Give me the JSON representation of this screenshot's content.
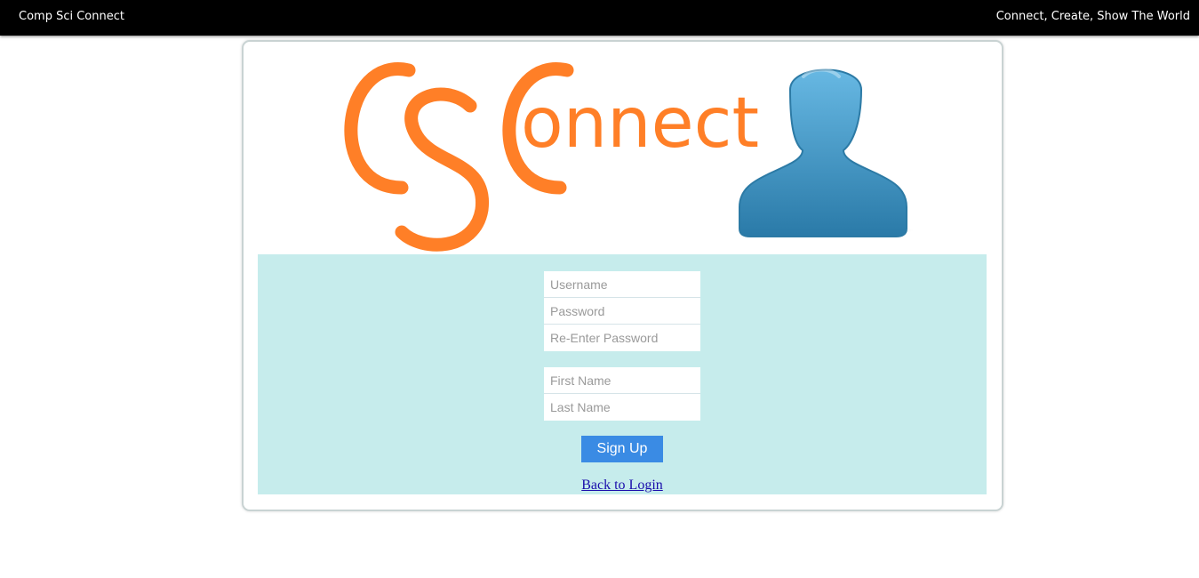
{
  "header": {
    "brand": "Comp Sci Connect",
    "tagline": "Connect, Create, Show The World"
  },
  "logo": {
    "text": "CSConnect",
    "icon": "user-silhouette-icon",
    "text_color": "#ff7f27",
    "icon_color": "#3a93c4"
  },
  "form": {
    "panel_color": "#c6ecec",
    "account_fields": [
      {
        "placeholder": "Username",
        "value": ""
      },
      {
        "placeholder": "Password",
        "value": ""
      },
      {
        "placeholder": "Re-Enter Password",
        "value": ""
      }
    ],
    "name_fields": [
      {
        "placeholder": "First Name",
        "value": ""
      },
      {
        "placeholder": "Last Name",
        "value": ""
      }
    ],
    "submit_label": "Sign Up",
    "submit_color": "#3a8be4",
    "back_link": "Back to Login"
  }
}
